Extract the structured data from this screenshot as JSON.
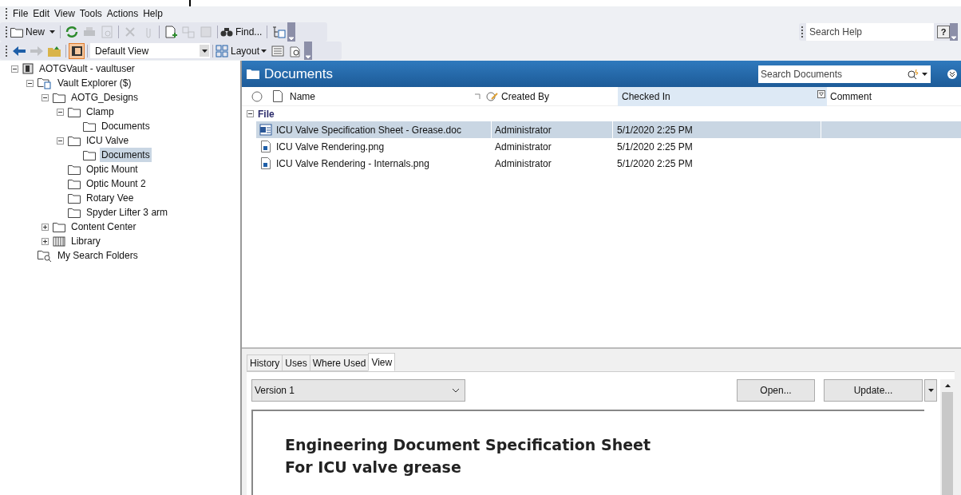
{
  "menu": [
    "File",
    "Edit",
    "View",
    "Tools",
    "Actions",
    "Help"
  ],
  "toolbar": {
    "new_label": "New",
    "find_label": "Find...",
    "view_select": "Default View",
    "layout_label": "Layout",
    "help_search": {
      "placeholder": "Search Help"
    },
    "help_button": "?"
  },
  "tree": [
    {
      "label": "AOTGVault - vaultuser",
      "kind": "vault",
      "expanded": true,
      "selected": false,
      "children": [
        {
          "label": "Vault Explorer ($)",
          "kind": "explorer",
          "expanded": true,
          "selected": false,
          "children": [
            {
              "label": "AOTG_Designs",
              "kind": "folder",
              "expanded": true,
              "selected": false,
              "children": [
                {
                  "label": "Clamp",
                  "kind": "folder",
                  "expanded": true,
                  "selected": false,
                  "children": [
                    {
                      "label": "Documents",
                      "kind": "folder",
                      "selected": false
                    }
                  ]
                },
                {
                  "label": "ICU Valve",
                  "kind": "folder",
                  "expanded": true,
                  "selected": false,
                  "children": [
                    {
                      "label": "Documents",
                      "kind": "folder",
                      "selected": true
                    }
                  ]
                },
                {
                  "label": "Optic Mount",
                  "kind": "folder",
                  "selected": false
                },
                {
                  "label": "Optic Mount 2",
                  "kind": "folder",
                  "selected": false
                },
                {
                  "label": "Rotary Vee",
                  "kind": "folder",
                  "selected": false
                },
                {
                  "label": "Spyder Lifter 3 arm",
                  "kind": "folder",
                  "selected": false
                }
              ]
            },
            {
              "label": "Content Center",
              "kind": "folder",
              "expanded": false,
              "selected": false
            },
            {
              "label": "Library",
              "kind": "library",
              "expanded": false,
              "selected": false
            }
          ]
        },
        {
          "label": "My Search Folders",
          "kind": "search",
          "selected": false
        }
      ]
    }
  ],
  "panel": {
    "title": "Documents",
    "search": {
      "placeholder": "Search Documents"
    }
  },
  "table": {
    "columns": [
      "Name",
      "Created By",
      "Checked In",
      "Comment"
    ],
    "group": "File",
    "group_expanded": true,
    "rows": [
      {
        "name": "ICU Valve Specification Sheet - Grease.doc",
        "kind": "doc",
        "created_by": "Administrator",
        "checked_in": "5/1/2020 2:25 PM",
        "selected": true
      },
      {
        "name": "ICU Valve Rendering.png",
        "kind": "image",
        "created_by": "Administrator",
        "checked_in": "5/1/2020 2:25 PM",
        "selected": false
      },
      {
        "name": "ICU Valve Rendering - Internals.png",
        "kind": "image",
        "created_by": "Administrator",
        "checked_in": "5/1/2020 2:25 PM",
        "selected": false
      }
    ]
  },
  "tabs": [
    {
      "label": "History",
      "selected": false
    },
    {
      "label": "Uses",
      "selected": false
    },
    {
      "label": "Where Used",
      "selected": false
    },
    {
      "label": "View",
      "selected": true
    }
  ],
  "preview": {
    "version": "Version 1",
    "open_button": "Open...",
    "update_button": "Update...",
    "heading": "Engineering Document Specification Sheet",
    "subheading": "For ICU valve grease"
  }
}
